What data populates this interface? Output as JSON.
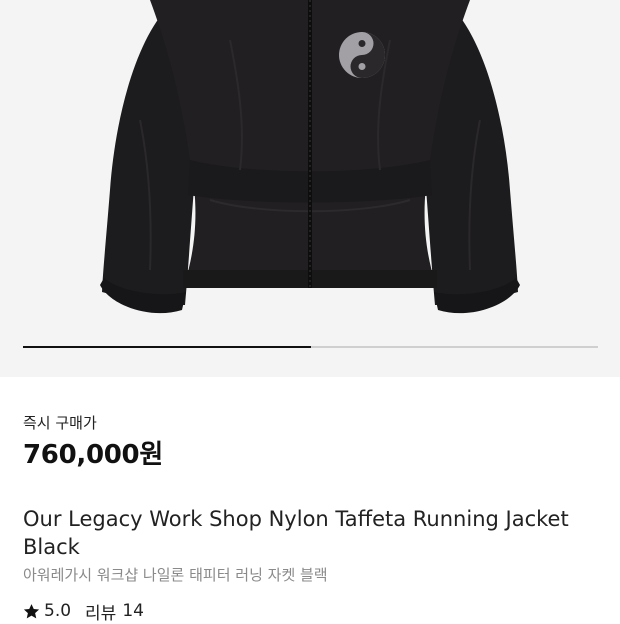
{
  "product_image": {
    "alt": "Our Legacy Work Shop Nylon Taffeta Running Jacket Black",
    "icon": "jacket-image",
    "logo_icon": "yin-yang-logo-icon"
  },
  "carousel": {
    "progress": 0.5
  },
  "price_section": {
    "label": "즉시 구매가",
    "value": "760,000원"
  },
  "product": {
    "title": "Our Legacy Work Shop Nylon Taffeta Running Jacket Black",
    "subtitle": "아워레가시 워크샵 나일론 태피터 러닝 자켓 블랙"
  },
  "rating": {
    "icon": "star-icon",
    "value": "5.0",
    "review_label": "리뷰",
    "review_count": "14"
  }
}
